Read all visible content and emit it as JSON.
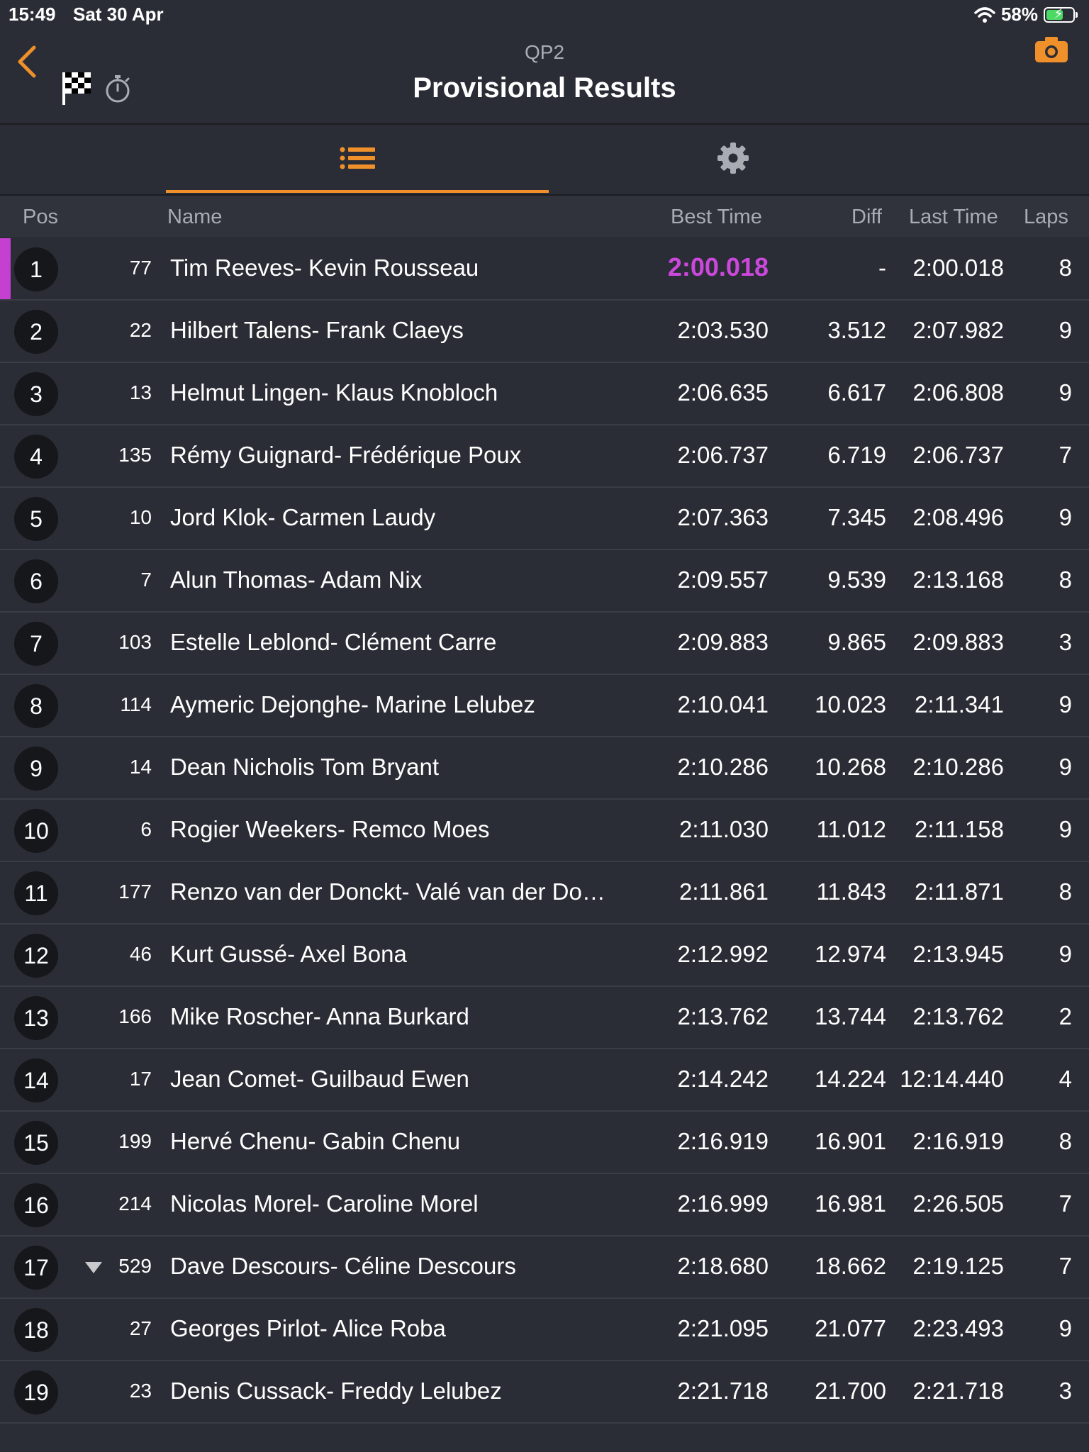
{
  "status_bar": {
    "time": "15:49",
    "date": "Sat 30 Apr",
    "battery": "58%"
  },
  "header": {
    "subtitle": "QP2",
    "title": "Provisional Results"
  },
  "colors": {
    "accent": "#f0902a",
    "fastest": "#cc47dc"
  },
  "icons": {
    "back": "chevron-left-icon",
    "flag": "checkered-flag-icon",
    "stopwatch": "stopwatch-icon",
    "camera": "camera-icon",
    "list": "list-icon",
    "settings": "gear-icon"
  },
  "columns": {
    "pos": "Pos",
    "name": "Name",
    "best": "Best Time",
    "diff": "Diff",
    "last": "Last Time",
    "laps": "Laps"
  },
  "rows": [
    {
      "pos": "1",
      "num": "77",
      "name": "Tim Reeves- Kevin Rousseau",
      "best": "2:00.018",
      "diff": "-",
      "last": "2:00.018",
      "laps": "8",
      "fastest": true
    },
    {
      "pos": "2",
      "num": "22",
      "name": "Hilbert Talens- Frank Claeys",
      "best": "2:03.530",
      "diff": "3.512",
      "last": "2:07.982",
      "laps": "9"
    },
    {
      "pos": "3",
      "num": "13",
      "name": "Helmut Lingen- Klaus Knobloch",
      "best": "2:06.635",
      "diff": "6.617",
      "last": "2:06.808",
      "laps": "9"
    },
    {
      "pos": "4",
      "num": "135",
      "name": "Rémy Guignard- Frédérique Poux",
      "best": "2:06.737",
      "diff": "6.719",
      "last": "2:06.737",
      "laps": "7"
    },
    {
      "pos": "5",
      "num": "10",
      "name": "Jord Klok- Carmen Laudy",
      "best": "2:07.363",
      "diff": "7.345",
      "last": "2:08.496",
      "laps": "9"
    },
    {
      "pos": "6",
      "num": "7",
      "name": "Alun Thomas- Adam Nix",
      "best": "2:09.557",
      "diff": "9.539",
      "last": "2:13.168",
      "laps": "8"
    },
    {
      "pos": "7",
      "num": "103",
      "name": "Estelle Leblond- Clément Carre",
      "best": "2:09.883",
      "diff": "9.865",
      "last": "2:09.883",
      "laps": "3"
    },
    {
      "pos": "8",
      "num": "114",
      "name": "Aymeric Dejonghe- Marine Lelubez",
      "best": "2:10.041",
      "diff": "10.023",
      "last": "2:11.341",
      "laps": "9"
    },
    {
      "pos": "9",
      "num": "14",
      "name": "Dean Nicholis Tom Bryant",
      "best": "2:10.286",
      "diff": "10.268",
      "last": "2:10.286",
      "laps": "9"
    },
    {
      "pos": "10",
      "num": "6",
      "name": "Rogier Weekers- Remco Moes",
      "best": "2:11.030",
      "diff": "11.012",
      "last": "2:11.158",
      "laps": "9"
    },
    {
      "pos": "11",
      "num": "177",
      "name": "Renzo van der Donckt- Valé van der Do…",
      "best": "2:11.861",
      "diff": "11.843",
      "last": "2:11.871",
      "laps": "8"
    },
    {
      "pos": "12",
      "num": "46",
      "name": "Kurt Gussé- Axel Bona",
      "best": "2:12.992",
      "diff": "12.974",
      "last": "2:13.945",
      "laps": "9"
    },
    {
      "pos": "13",
      "num": "166",
      "name": "Mike Roscher- Anna Burkard",
      "best": "2:13.762",
      "diff": "13.744",
      "last": "2:13.762",
      "laps": "2"
    },
    {
      "pos": "14",
      "num": "17",
      "name": "Jean Comet- Guilbaud Ewen",
      "best": "2:14.242",
      "diff": "14.224",
      "last": "12:14.440",
      "laps": "4"
    },
    {
      "pos": "15",
      "num": "199",
      "name": "Hervé Chenu- Gabin Chenu",
      "best": "2:16.919",
      "diff": "16.901",
      "last": "2:16.919",
      "laps": "8"
    },
    {
      "pos": "16",
      "num": "214",
      "name": "Nicolas Morel- Caroline Morel",
      "best": "2:16.999",
      "diff": "16.981",
      "last": "2:26.505",
      "laps": "7"
    },
    {
      "pos": "17",
      "num": "529",
      "name": "Dave Descours- Céline Descours",
      "best": "2:18.680",
      "diff": "18.662",
      "last": "2:19.125",
      "laps": "7",
      "trend": "down"
    },
    {
      "pos": "18",
      "num": "27",
      "name": "Georges Pirlot- Alice Roba",
      "best": "2:21.095",
      "diff": "21.077",
      "last": "2:23.493",
      "laps": "9"
    },
    {
      "pos": "19",
      "num": "23",
      "name": "Denis Cussack- Freddy Lelubez",
      "best": "2:21.718",
      "diff": "21.700",
      "last": "2:21.718",
      "laps": "3"
    }
  ]
}
